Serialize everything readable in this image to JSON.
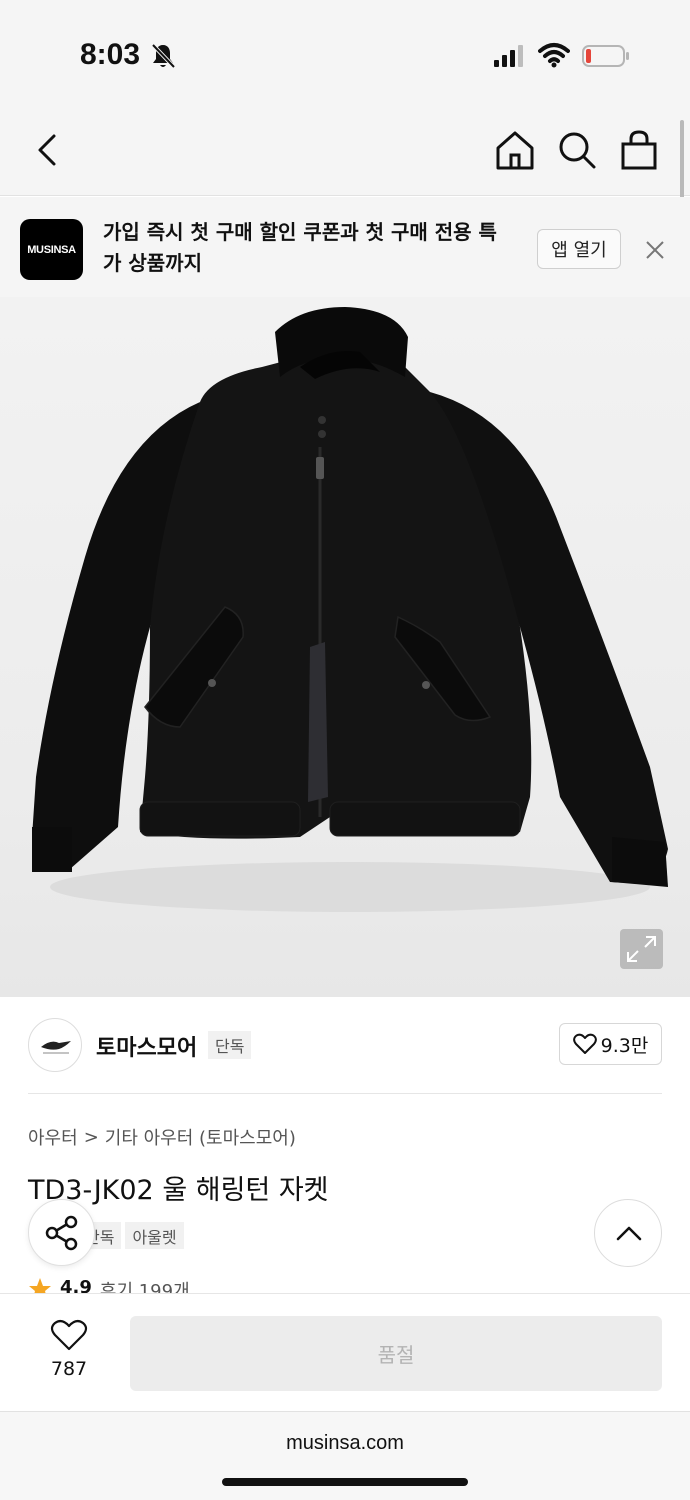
{
  "status_bar": {
    "time": "8:03",
    "icons": [
      "bell-slash-icon",
      "signal-icon",
      "wifi-icon",
      "battery-low-icon"
    ],
    "battery_color": "#e5453a"
  },
  "nav": {
    "icons": [
      "back-icon",
      "home-icon",
      "search-icon",
      "shopping-bag-icon"
    ]
  },
  "banner": {
    "logo_text": "MUSINSA",
    "message": "가입 즉시 첫 구매 할인 쿠폰과 첫 구매 전용 특가 상품까지",
    "open_app_label": "앱 열기",
    "close_icon": "close-icon"
  },
  "product_image": {
    "subject": "black-jacket",
    "expand_icon": "expand-icon"
  },
  "brand": {
    "name": "토마스모어",
    "tag": "단독",
    "like_count": "9.3만",
    "like_icon": "heart-outline-icon"
  },
  "breadcrumb": {
    "category": "아우터",
    "separator": ">",
    "subcategory": "기타 아우터 (토마스모어)"
  },
  "product": {
    "title": "TD3-JK02 울 해링턴 자켓",
    "tags": [
      "단독",
      "아울렛"
    ],
    "rating": "4.9",
    "reviews": "후기 199개"
  },
  "floating": {
    "share_icon": "share-icon",
    "scroll_up_icon": "chevron-up-icon"
  },
  "bottom_bar": {
    "like_count": "787",
    "soldout_label": "품절"
  },
  "browser": {
    "url": "musinsa.com"
  },
  "colors": {
    "background": "#ffffff",
    "header_bg": "#f5f5f5",
    "star": "#f5a623",
    "disabled_btn": "#ececec"
  }
}
